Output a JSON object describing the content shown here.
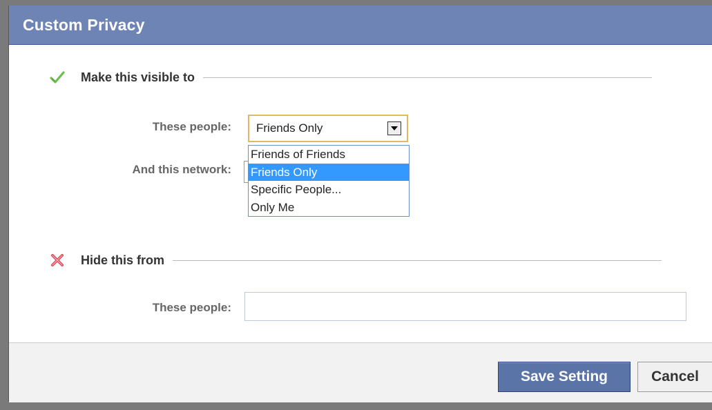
{
  "dialog": {
    "title": "Custom Privacy"
  },
  "visible_section": {
    "heading": "Make this visible to",
    "icon": "check-icon",
    "these_people_label": "These people:",
    "network_label": "And this network:",
    "selected_value": "Friends Only",
    "options": [
      "Friends of Friends",
      "Friends Only",
      "Specific People...",
      "Only Me"
    ],
    "highlighted_option": "Friends Only"
  },
  "hide_section": {
    "heading": "Hide this from",
    "icon": "x-icon",
    "these_people_label": "These people:",
    "input_value": ""
  },
  "footer": {
    "save_label": "Save Setting",
    "cancel_label": "Cancel"
  },
  "colors": {
    "title_bar": "#6d84b4",
    "check_icon": "#6bbf4a",
    "x_icon": "#d94b5a",
    "highlight": "#3399ff",
    "save_button": "#5b74a8"
  }
}
